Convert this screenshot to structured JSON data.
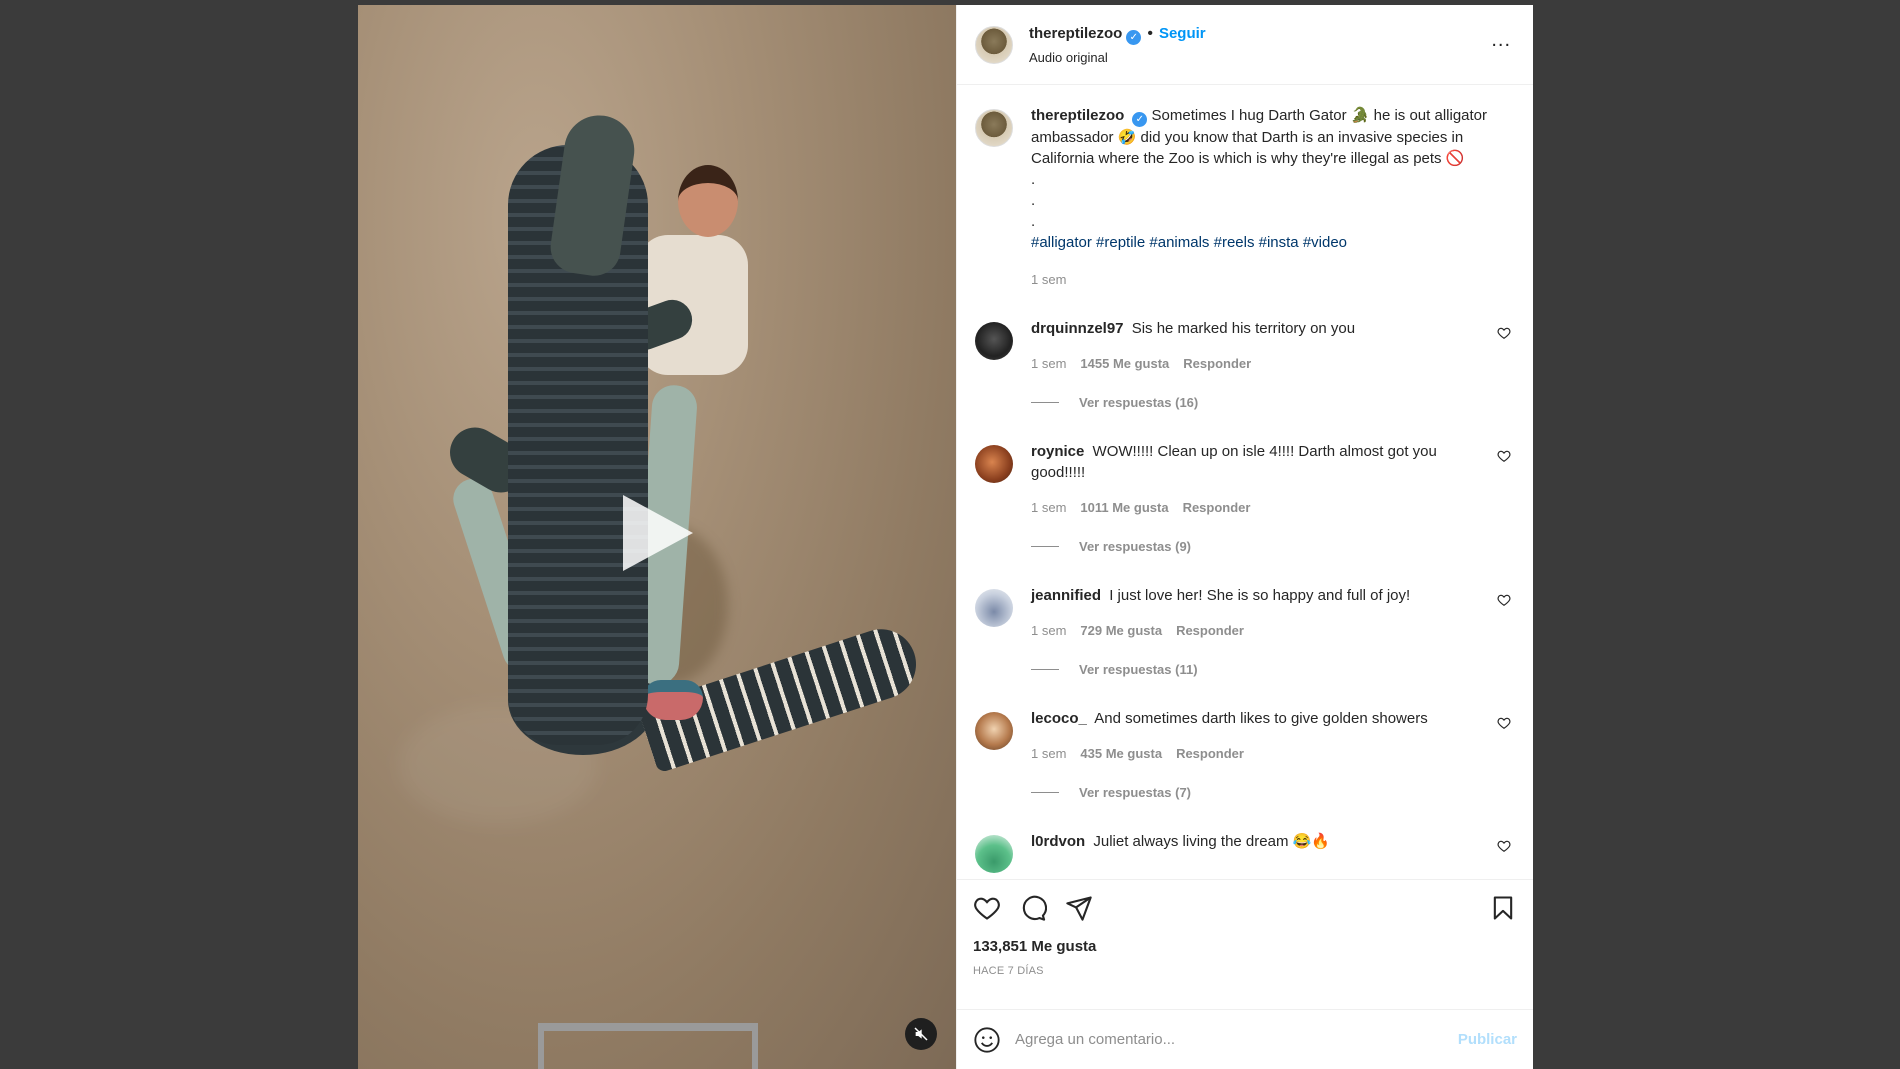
{
  "post": {
    "author": "thereptilezoo",
    "follow_label": "Seguir",
    "audio_label": "Audio original",
    "more_label": "...",
    "caption_text": "Sometimes I hug Darth Gator 🐊 he is out alligator ambassador 🤣 did you know that Darth is an invasive species in California where the Zoo is which is why they're illegal as pets 🚫",
    "caption_dots": [
      ".",
      ".",
      "."
    ],
    "hashtags": "#alligator #reptile #animals #reels #insta #video",
    "caption_time": "1 sem"
  },
  "comments": [
    {
      "user": "drquinnzel97",
      "text": "Sis he marked his territory on you",
      "time": "1 sem",
      "likes": "1455 Me gusta",
      "reply": "Responder",
      "replies": "Ver respuestas (16)"
    },
    {
      "user": "roynice",
      "text": "WOW!!!!! Clean up on isle 4!!!! Darth almost got you good!!!!!",
      "time": "1 sem",
      "likes": "1011 Me gusta",
      "reply": "Responder",
      "replies": "Ver respuestas (9)"
    },
    {
      "user": "jeannified",
      "text": "I just love her! She is so happy and full of joy!",
      "time": "1 sem",
      "likes": "729 Me gusta",
      "reply": "Responder",
      "replies": "Ver respuestas (11)"
    },
    {
      "user": "lecoco_",
      "text": "And sometimes darth likes to give golden showers",
      "time": "1 sem",
      "likes": "435 Me gusta",
      "reply": "Responder",
      "replies": "Ver respuestas (7)"
    },
    {
      "user": "l0rdvon",
      "text": "Juliet always living the dream 😂🔥"
    }
  ],
  "engagement": {
    "likes": "133,851 Me gusta",
    "time_ago": "HACE 7 DÍAS"
  },
  "composer": {
    "placeholder": "Agrega un comentario...",
    "publish_label": "Publicar"
  },
  "icons": {
    "verified": "verified-badge-icon",
    "like": "heart-icon",
    "comment": "comment-bubble-icon",
    "share": "paper-plane-icon",
    "save": "bookmark-icon",
    "emoji": "smiley-icon",
    "mute": "muted-speaker-icon",
    "play": "play-icon"
  },
  "colors": {
    "accent": "#0095f6",
    "verified": "#3897f0",
    "publish_disabled": "#b2dffc",
    "hashtag": "#00376b"
  }
}
